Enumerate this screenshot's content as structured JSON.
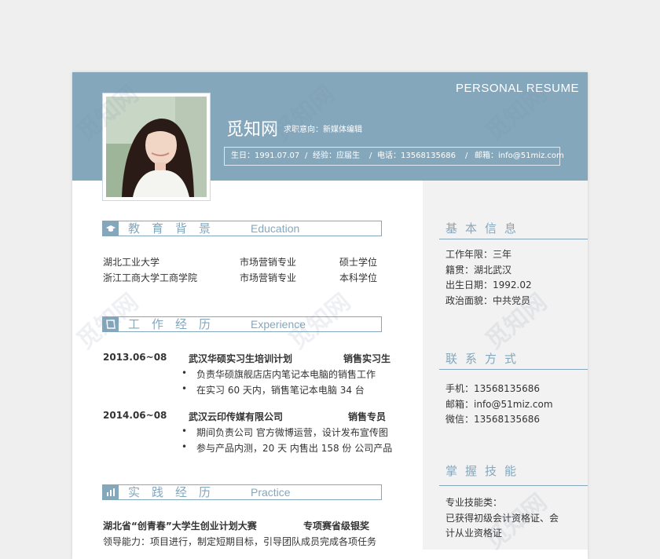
{
  "header": {
    "title_en": "PERSONAL RESUME",
    "name": "觅知网",
    "intent": "求职意向：新媒体编辑",
    "birth": "生日：1991.07.07",
    "experience": "经验：应届生",
    "phone": "电话：13568135686",
    "email": "邮箱：info@51miz.com",
    "sep": "/"
  },
  "education": {
    "title_cn": "教育背景",
    "title_en": "Education",
    "rows": [
      {
        "school": "湖北工业大学",
        "major": "市场营销专业",
        "degree": "硕士学位"
      },
      {
        "school": "浙江工商大学工商学院",
        "major": "市场营销专业",
        "degree": "本科学位"
      }
    ]
  },
  "work": {
    "title_cn": "工作经历",
    "title_en": "Experience",
    "jobs": [
      {
        "date": "2013.06~08",
        "company": "武汉华硕实习生培训计划",
        "role": "销售实习生",
        "bullets": [
          "负责华硕旗舰店店内笔记本电脑的销售工作",
          "在实习 60 天内，销售笔记本电脑 34 台"
        ]
      },
      {
        "date": "2014.06~08",
        "company": "武汉云印传媒有限公司",
        "role": "销售专员",
        "bullets": [
          "期间负责公司 官方微博运营，设计发布宣传图",
          "参与产品内测，20 天 内售出 158 份 公司产品"
        ]
      }
    ]
  },
  "practice": {
    "title_cn": "实践经历",
    "title_en": "Practice",
    "event": "湖北省“创青春”大学生创业计划大赛",
    "award": "专项赛省级银奖",
    "desc": "领导能力：项目进行，制定短期目标，引导团队成员完成各项任务"
  },
  "sidebar": {
    "basic_title": "基本信息",
    "basic": [
      "工作年限：三年",
      "籍贯：湖北武汉",
      "出生日期：1992.02",
      "政治面貌：中共党员"
    ],
    "contact_title": "联系方式",
    "contact": [
      "手机：13568135686",
      "邮箱：info@51miz.com",
      "微信：13568135686"
    ],
    "skills_title": "掌握技能",
    "skills": [
      "专业技能类：",
      "已获得初级会计资格证、会",
      "计从业资格证"
    ]
  },
  "bullet_char": "•",
  "watermark": "觅知网",
  "colors": {
    "accent": "#85a7bc",
    "sidebar_bg": "#f2f2f2"
  }
}
